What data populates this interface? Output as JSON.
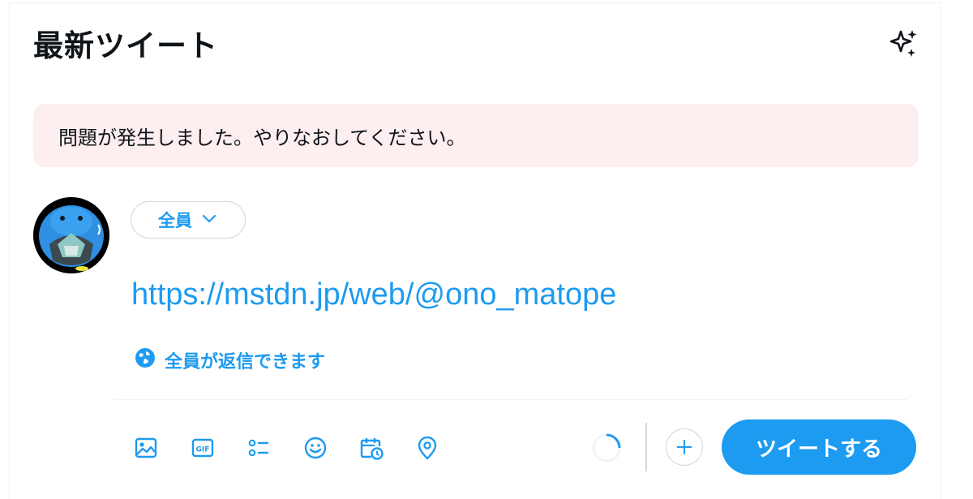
{
  "header": {
    "title": "最新ツイート",
    "top_tweets_icon": "sparkle-icon"
  },
  "error": {
    "message": "問題が発生しました。やりなおしてください。"
  },
  "composer": {
    "avatar_icon": "avatar",
    "audience_label": "全員",
    "text": "https://mstdn.jp/web/@ono_matope",
    "reply_setting_label": "全員が返信できます"
  },
  "toolbar": {
    "icons": [
      "image-icon",
      "gif-icon",
      "poll-icon",
      "emoji-icon",
      "schedule-icon",
      "location-icon"
    ],
    "tweet_button_label": "ツイートする"
  },
  "colors": {
    "accent": "#1d9bf0",
    "error_bg": "#fdeef0",
    "border": "#cfd9de",
    "text": "#0f1419"
  }
}
